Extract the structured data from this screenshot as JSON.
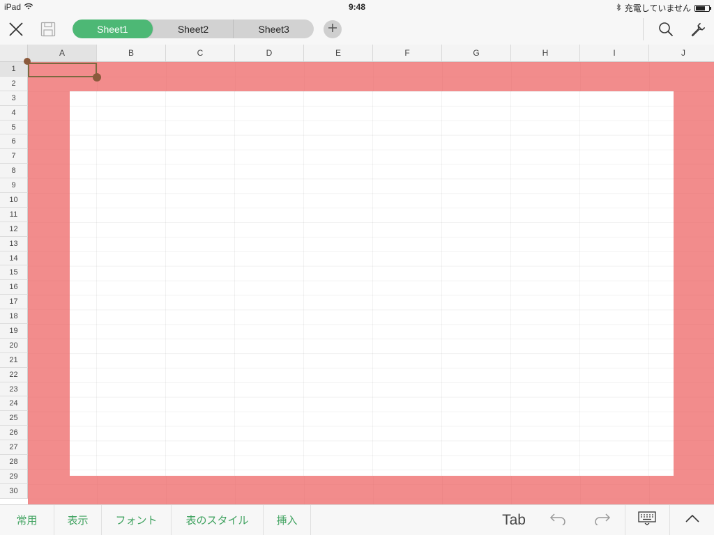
{
  "status_bar": {
    "device": "iPad",
    "time": "9:48",
    "charging_text": "充電していません",
    "battery_level": 0.7
  },
  "toolbar": {
    "sheets": [
      "Sheet1",
      "Sheet2",
      "Sheet3"
    ],
    "active_sheet": "Sheet1",
    "icons": {
      "close": "close-icon",
      "save": "save-icon",
      "add_sheet": "plus-icon",
      "search": "search-icon",
      "settings": "wrench-icon"
    }
  },
  "grid": {
    "columns": [
      "A",
      "B",
      "C",
      "D",
      "E",
      "F",
      "G",
      "H",
      "I",
      "J"
    ],
    "rows": [
      "1",
      "2",
      "3",
      "4",
      "5",
      "6",
      "7",
      "8",
      "9",
      "10",
      "11",
      "12",
      "13",
      "14",
      "15",
      "16",
      "17",
      "18",
      "19",
      "20",
      "21",
      "22",
      "23",
      "24",
      "25",
      "26",
      "27",
      "28",
      "29",
      "30"
    ],
    "selected_cell": "A1",
    "fill_color": "#ee6666",
    "accent_color": "#4db875"
  },
  "bottom_bar": {
    "menus": [
      "常用",
      "表示",
      "フォント",
      "表のスタイル",
      "挿入"
    ],
    "tab_label": "Tab",
    "icons": {
      "undo": "undo-icon",
      "redo": "redo-icon",
      "keyboard": "keyboard-icon",
      "collapse": "chevron-up-icon"
    }
  }
}
